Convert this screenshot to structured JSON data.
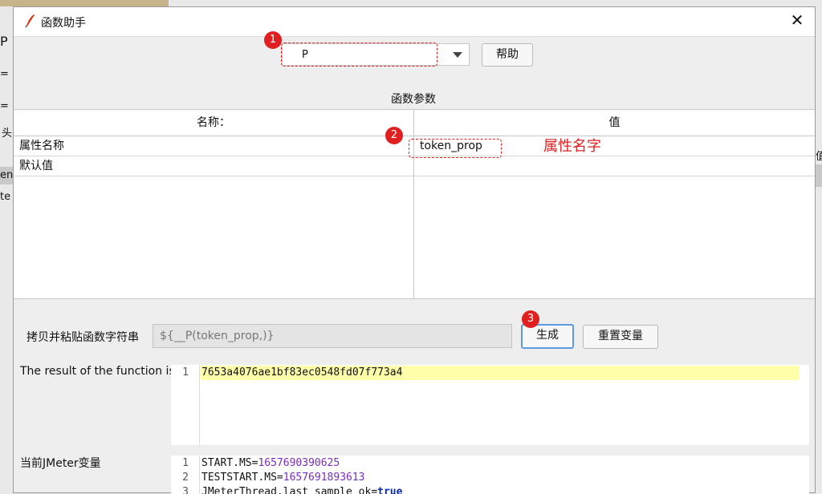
{
  "background": {
    "fragments": [
      "P",
      "=",
      "=",
      "头",
      "en",
      "te",
      "值"
    ]
  },
  "dialog": {
    "title": "函数助手",
    "close_glyph": "✕"
  },
  "function_selector": {
    "selected": "P",
    "help_label": "帮助"
  },
  "params": {
    "section_label": "函数参数",
    "header_name": "名称：",
    "header_value": "值",
    "rows": [
      {
        "name": "属性名称",
        "value": "token_prop"
      },
      {
        "name": "默认值",
        "value": ""
      }
    ],
    "annotation": "属性名字"
  },
  "badges": [
    "1",
    "2",
    "3"
  ],
  "copy_string": {
    "label": "拷贝并粘贴函数字符串",
    "value": "${__P(token_prop,)}",
    "generate_label": "生成",
    "reset_label": "重置变量"
  },
  "result": {
    "label": "The result of the function is",
    "lines": [
      {
        "n": "1",
        "text": "7653a4076ae1bf83ec0548fd07f773a4"
      }
    ]
  },
  "vars": {
    "label": "当前JMeter变量",
    "lines": [
      {
        "n": "1",
        "key": "START.MS=",
        "val": "1657690390625"
      },
      {
        "n": "2",
        "key": "TESTSTART.MS=",
        "val": "1657691893613"
      },
      {
        "n": "3",
        "key": "JMeterThread.last_sample_ok=",
        "val": "true"
      }
    ]
  },
  "colors": {
    "accent_red": "#e02020",
    "highlight_yellow": "#ffffaa",
    "button_focus": "#5d9be0"
  }
}
